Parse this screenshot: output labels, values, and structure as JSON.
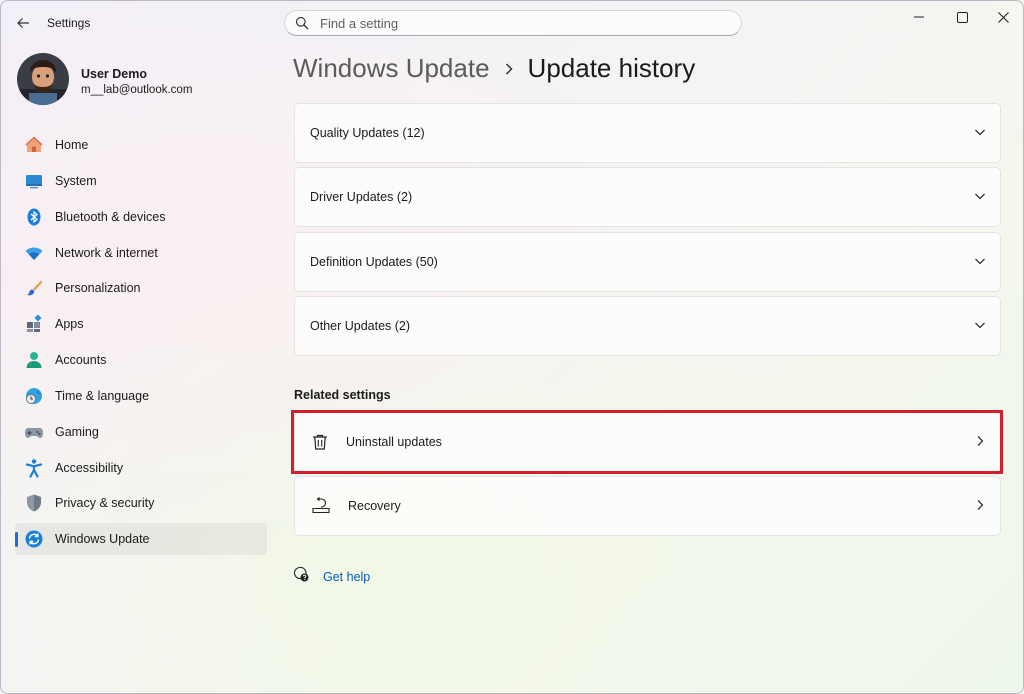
{
  "app": {
    "title": "Settings"
  },
  "search": {
    "placeholder": "Find a setting"
  },
  "user": {
    "name": "User Demo",
    "email": "m__lab@outlook.com"
  },
  "nav": [
    {
      "label": "Home",
      "icon": "home-icon"
    },
    {
      "label": "System",
      "icon": "system-icon"
    },
    {
      "label": "Bluetooth & devices",
      "icon": "bluetooth-icon"
    },
    {
      "label": "Network & internet",
      "icon": "wifi-icon"
    },
    {
      "label": "Personalization",
      "icon": "brush-icon"
    },
    {
      "label": "Apps",
      "icon": "apps-icon"
    },
    {
      "label": "Accounts",
      "icon": "accounts-icon"
    },
    {
      "label": "Time & language",
      "icon": "globe-clock-icon"
    },
    {
      "label": "Gaming",
      "icon": "gamepad-icon"
    },
    {
      "label": "Accessibility",
      "icon": "accessibility-icon"
    },
    {
      "label": "Privacy & security",
      "icon": "shield-icon"
    },
    {
      "label": "Windows Update",
      "icon": "update-icon",
      "selected": true
    }
  ],
  "breadcrumb": {
    "parent": "Windows Update",
    "current": "Update history"
  },
  "history": [
    {
      "label": "Quality Updates (12)"
    },
    {
      "label": "Driver Updates (2)"
    },
    {
      "label": "Definition Updates (50)"
    },
    {
      "label": "Other Updates (2)"
    }
  ],
  "related": {
    "title": "Related settings",
    "items": [
      {
        "label": "Uninstall updates",
        "icon": "trash-icon"
      },
      {
        "label": "Recovery",
        "icon": "recovery-icon"
      }
    ]
  },
  "help": {
    "label": "Get help"
  },
  "colors": {
    "accent": "#1a6ed8",
    "highlight": "#d21f2a",
    "link": "#0b5cad"
  }
}
